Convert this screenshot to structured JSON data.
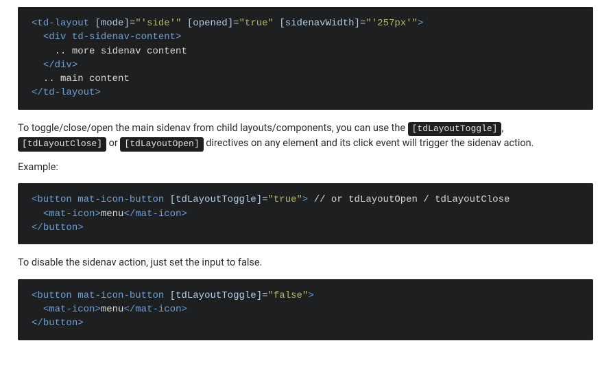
{
  "code1": {
    "line1": {
      "open": "<",
      "tag": "td-layout",
      "a1": "[mode]",
      "eq1": "=",
      "v1": "\"'side'\"",
      "a2": "[opened]",
      "eq2": "=",
      "v2": "\"true\"",
      "a3": "[sidenavWidth]",
      "eq3": "=",
      "v3": "\"'257px'\"",
      "close": ">"
    },
    "line2": {
      "indent": "  ",
      "open": "<",
      "tag": "div",
      "attr": "td-sidenav-content",
      "close": ">"
    },
    "line3": {
      "indent": "    ",
      "text": ".. more sidenav content"
    },
    "line4": {
      "indent": "  ",
      "open": "</",
      "tag": "div",
      "close": ">"
    },
    "line5": {
      "indent": "  ",
      "text": ".. main content"
    },
    "line6": {
      "open": "</",
      "tag": "td-layout",
      "close": ">"
    }
  },
  "para1": {
    "pre": "To toggle/close/open the main sidenav from child layouts/components, you can use the ",
    "c1": "[tdLayoutToggle]",
    "mid1": ", ",
    "c2": "[tdLayoutClose]",
    "mid2": " or ",
    "c3": "[tdLayoutOpen]",
    "post": " directives on any element and its click event will trigger the sidenav action."
  },
  "para2": "Example:",
  "code2": {
    "line1": {
      "open": "<",
      "tag": "button",
      "attr1": "mat-icon-button",
      "a2": "[tdLayoutToggle]",
      "eq": "=",
      "v": "\"true\"",
      "close": ">",
      "cmt": " // or tdLayoutOpen / tdLayoutClose"
    },
    "line2": {
      "indent": "  ",
      "open": "<",
      "tag": "mat-icon",
      "close": ">",
      "text": "menu",
      "open2": "</",
      "tag2": "mat-icon",
      "close2": ">"
    },
    "line3": {
      "open": "</",
      "tag": "button",
      "close": ">"
    }
  },
  "para3": "To disable the sidenav action, just set the input to false.",
  "code3": {
    "line1": {
      "open": "<",
      "tag": "button",
      "attr1": "mat-icon-button",
      "a2": "[tdLayoutToggle]",
      "eq": "=",
      "v": "\"false\"",
      "close": ">"
    },
    "line2": {
      "indent": "  ",
      "open": "<",
      "tag": "mat-icon",
      "close": ">",
      "text": "menu",
      "open2": "</",
      "tag2": "mat-icon",
      "close2": ">"
    },
    "line3": {
      "open": "</",
      "tag": "button",
      "close": ">"
    }
  }
}
